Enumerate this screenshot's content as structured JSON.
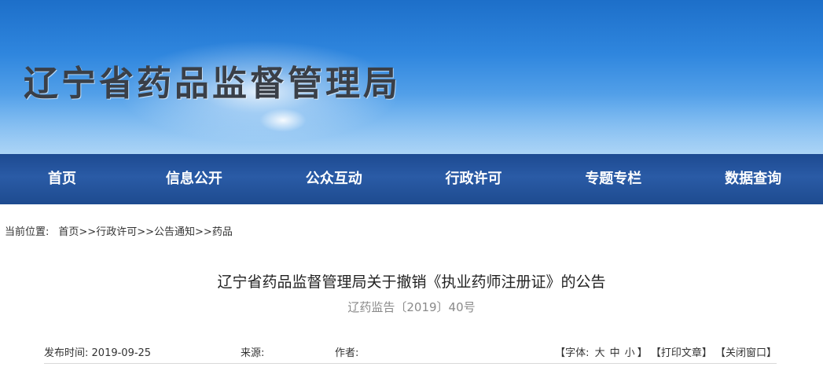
{
  "header": {
    "site_title": "辽宁省药品监督管理局"
  },
  "nav": {
    "items": [
      {
        "label": "首页"
      },
      {
        "label": "信息公开"
      },
      {
        "label": "公众互动"
      },
      {
        "label": "行政许可"
      },
      {
        "label": "专题专栏"
      },
      {
        "label": "数据查询"
      }
    ]
  },
  "breadcrumb": {
    "prefix": "当前位置:",
    "items": [
      "首页",
      "行政许可",
      "公告通知",
      "药品"
    ],
    "separator": ">>"
  },
  "article": {
    "title": "辽宁省药品监督管理局关于撤销《执业药师注册证》的公告",
    "doc_number": "辽药监告〔2019〕40号",
    "publish_label": "发布时间:",
    "publish_date": "2019-09-25",
    "source_label": "来源:",
    "source_value": "",
    "author_label": "作者:",
    "author_value": ""
  },
  "tools": {
    "font_label": "【字体:",
    "size_large": "大",
    "size_medium": "中",
    "size_small": "小",
    "font_close": "】",
    "print": "【打印文章】",
    "close": "【关闭窗口】"
  },
  "colors": {
    "nav_bg": "#2a5ba6",
    "banner_top": "#1d6fc9",
    "banner_bottom": "#8cc4f3",
    "title_text": "#3a3f47"
  }
}
